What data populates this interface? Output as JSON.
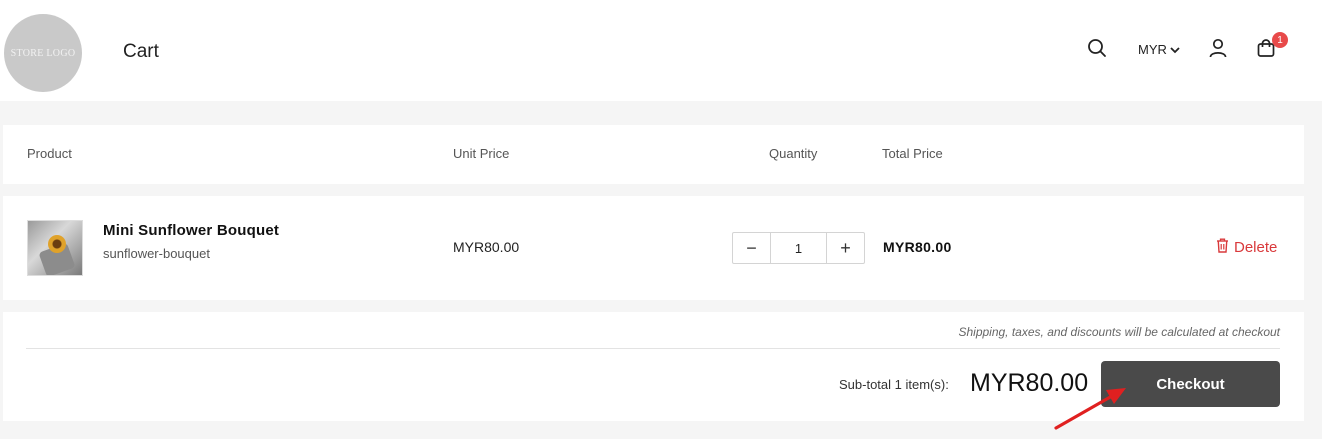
{
  "header": {
    "logo_text": "STORE LOGO",
    "title": "Cart",
    "currency": "MYR",
    "cart_count": "1",
    "icons": [
      "search-icon",
      "chevron-down-icon",
      "user-icon",
      "cart-icon"
    ]
  },
  "table": {
    "columns": [
      "Product",
      "Unit Price",
      "Quantity",
      "Total Price"
    ]
  },
  "items": [
    {
      "name": "Mini Sunflower Bouquet",
      "handle": "sunflower-bouquet",
      "unit_price": "MYR80.00",
      "quantity": "1",
      "total_price": "MYR80.00",
      "delete_label": "Delete",
      "decrement": "−",
      "increment": "+"
    }
  ],
  "summary": {
    "note": "Shipping, taxes, and discounts will be calculated at checkout",
    "subtotal_label": "Sub-total 1 item(s):",
    "subtotal_amount": "MYR80.00",
    "checkout_label": "Checkout"
  },
  "colors": {
    "accent_delete": "#d9393b",
    "badge": "#e84a4a",
    "checkout_bg": "#4a4a4a",
    "annotation_arrow": "#e02020"
  }
}
